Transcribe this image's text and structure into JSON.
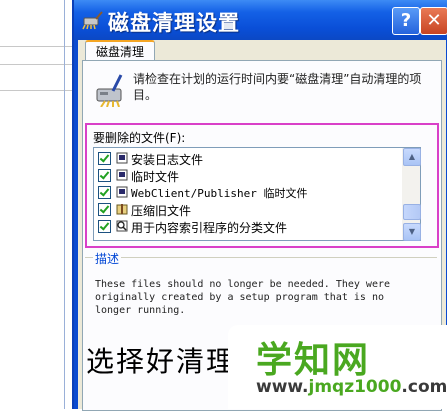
{
  "window": {
    "title": "磁盘清理设置",
    "help_label": "?",
    "close_label": "✕"
  },
  "tab": {
    "label": "磁盘清理"
  },
  "intro": "请检查在计划的运行时间内要“磁盘清理”自动清理的项目。",
  "files_label": "要删除的文件(F):",
  "files": [
    {
      "label": "安装日志文件",
      "checked": true,
      "icon": "log-file-icon"
    },
    {
      "label": "临时文件",
      "checked": true,
      "icon": "temp-file-icon"
    },
    {
      "label": "WebClient/Publisher 临时文件",
      "checked": true,
      "icon": "webclient-file-icon"
    },
    {
      "label": "压缩旧文件",
      "checked": true,
      "icon": "compress-icon"
    },
    {
      "label": "用于内容索引程序的分类文件",
      "checked": true,
      "icon": "search-index-icon"
    }
  ],
  "description": {
    "label": "描述",
    "text": "These files should no longer be needed. They were originally created by a setup program that is no longer running."
  },
  "caption": "选择好清理",
  "watermark": {
    "main": "学知网",
    "url_prefix": "www.",
    "url_domain": "jmqz1000",
    "url_suffix": ".com"
  },
  "colors": {
    "titlebar": "#0a4fd8",
    "highlight_box": "#d940c8",
    "watermark_green": "#4aa820"
  }
}
